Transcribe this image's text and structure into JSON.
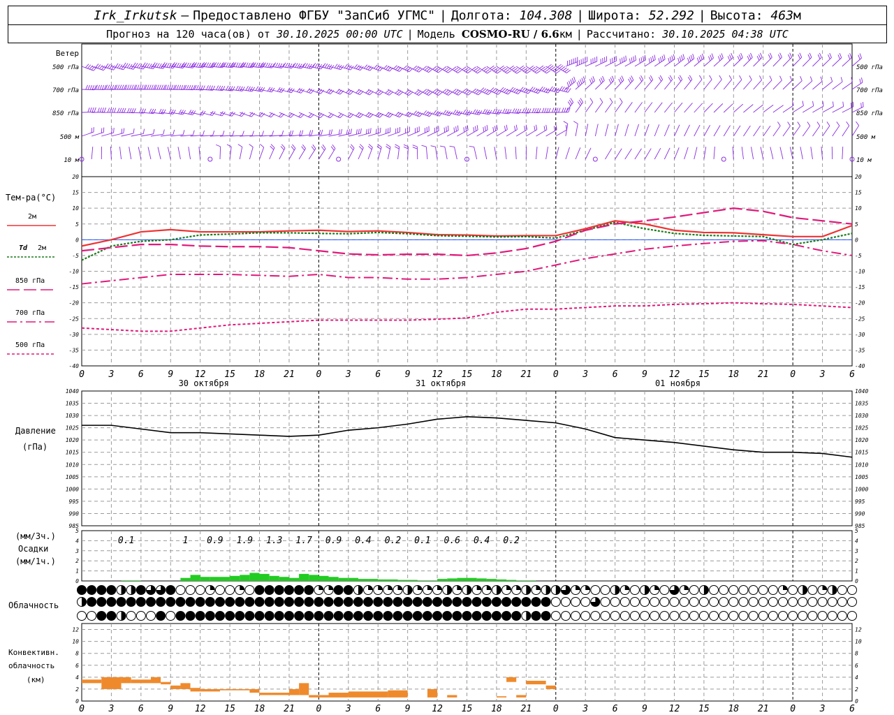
{
  "header": {
    "station": "Irk_Irkutsk",
    "dash": "—",
    "provider": "Предоставлено ФГБУ \"ЗапСиб УГМС\"",
    "lon_label": "Долгота:",
    "lon_value": "104.308",
    "lat_label": "Широта:",
    "lat_value": "52.292",
    "alt_label": "Высота:",
    "alt_value": "463",
    "alt_unit": "м",
    "forecast_prefix": "Прогноз на 120 часа(ов) от",
    "forecast_start": "30.10.2025 00:00 UTC",
    "model_label": "Модель",
    "model_name": "COSMO-RU / 6.6",
    "model_unit": "км",
    "calc_label": "Рассчитано:",
    "calc_time": "30.10.2025 04:38 UTC"
  },
  "labels": {
    "wind": "Ветер",
    "wind_levels": [
      "500 гПа",
      "700 гПа",
      "850 гПа",
      "500 м",
      "10 м"
    ],
    "temp_title": "Тем-ра(°С)",
    "legend_2m": "2м",
    "legend_td": "Td",
    "legend_td_level": "2м",
    "legend_850": "850 гПа",
    "legend_700": "700 гПа",
    "legend_500": "500 гПа",
    "pressure_title": "Давление",
    "pressure_unit": "(гПа)",
    "precip_3h": "(мм/3ч.)",
    "precip_title": "Осадки",
    "precip_1h": "(мм/1ч.)",
    "cloud_title": "Облачность",
    "conv_title_1": "Конвективн.",
    "conv_title_2": "облачность",
    "conv_unit": "(км)"
  },
  "colors": {
    "wind": "#8a2be2",
    "t2m": "#ee3333",
    "td": "#1a7a1a",
    "t850": "#e0197a",
    "precip": "#22cc22",
    "conv": "#ef8a2c",
    "pressure": "#000000"
  },
  "chart_data": [
    {
      "type": "line",
      "name": "temperature",
      "x_hours_ticks": [
        "0",
        "3",
        "6",
        "9",
        "12",
        "15",
        "18",
        "21",
        "0",
        "3",
        "6",
        "9",
        "12",
        "15",
        "18",
        "21",
        "0",
        "3",
        "6",
        "9",
        "12",
        "15",
        "18",
        "21",
        "0",
        "3",
        "6"
      ],
      "dates": [
        "30 октября",
        "31 октября",
        "01 ноября"
      ],
      "ylim": [
        -40,
        20
      ],
      "yticks": [
        20,
        15,
        10,
        5,
        0,
        -5,
        -10,
        -15,
        -20,
        -25,
        -30,
        -35,
        -40
      ],
      "x": [
        0,
        3,
        6,
        9,
        12,
        15,
        18,
        21,
        24,
        27,
        30,
        33,
        36,
        39,
        42,
        45,
        48,
        51,
        54,
        57,
        60,
        63,
        66,
        69,
        72,
        75,
        78
      ],
      "series": [
        {
          "name": "2м",
          "values": [
            -2,
            0,
            2.5,
            3.2,
            2.5,
            2.5,
            2.5,
            2.8,
            3,
            2.6,
            2.8,
            2.3,
            1.6,
            1.5,
            1.2,
            1.3,
            1.3,
            3.5,
            6,
            5,
            3,
            2.3,
            2.2,
            1.6,
            1,
            1,
            4.5
          ]
        },
        {
          "name": "Td 2м",
          "values": [
            -6.5,
            -2,
            -0.5,
            0,
            1.5,
            1.8,
            2.2,
            2.2,
            2,
            1.9,
            2.3,
            1.9,
            1.3,
            1.1,
            0.9,
            1,
            0.5,
            3,
            5.5,
            3.5,
            2,
            1.4,
            1.2,
            1,
            -1.5,
            0,
            2
          ]
        },
        {
          "name": "850 гПа",
          "values": [
            -3.5,
            -2.5,
            -1.5,
            -1.5,
            -2,
            -2.2,
            -2.2,
            -2.5,
            -3.5,
            -4.5,
            -4.8,
            -4.6,
            -4.6,
            -5,
            -4.2,
            -2.8,
            -0.5,
            3,
            5,
            6,
            7.2,
            8.6,
            10,
            9,
            7,
            6,
            5
          ]
        },
        {
          "name": "700 гПа",
          "values": [
            -14,
            -13,
            -12,
            -11,
            -11,
            -11,
            -11.3,
            -11.6,
            -11,
            -12,
            -12,
            -12.5,
            -12.5,
            -12,
            -11,
            -10,
            -8,
            -6,
            -4.5,
            -3,
            -2,
            -1.2,
            -0.5,
            -0.3,
            -1.5,
            -3.5,
            -5
          ]
        },
        {
          "name": "500 гПа",
          "values": [
            -28,
            -28.5,
            -29,
            -29,
            -28,
            -27,
            -26.5,
            -26,
            -25.5,
            -25.5,
            -25.5,
            -25.5,
            -25.2,
            -24.8,
            -23,
            -22,
            -22,
            -21.5,
            -21,
            -21,
            -20.5,
            -20.3,
            -20,
            -20.3,
            -20.5,
            -21,
            -21.5
          ]
        }
      ]
    },
    {
      "type": "line",
      "name": "pressure",
      "ylim": [
        985,
        1040
      ],
      "yticks": [
        1040,
        1035,
        1030,
        1025,
        1020,
        1015,
        1010,
        1005,
        1000,
        995,
        990,
        985
      ],
      "x": [
        0,
        3,
        6,
        9,
        12,
        15,
        18,
        21,
        24,
        27,
        30,
        33,
        36,
        39,
        42,
        45,
        48,
        51,
        54,
        57,
        60,
        63,
        66,
        69,
        72,
        75,
        78
      ],
      "values": [
        1026,
        1026,
        1024.5,
        1023,
        1023,
        1022.5,
        1022,
        1021.5,
        1022,
        1024,
        1025,
        1026.5,
        1028.5,
        1029.5,
        1029,
        1028,
        1027,
        1024.5,
        1021,
        1020,
        1019,
        1017.5,
        1016,
        1015,
        1015,
        1014.5,
        1013
      ]
    },
    {
      "type": "bar",
      "name": "precipitation",
      "ylim": [
        0,
        5
      ],
      "yticks": [
        5,
        4,
        3,
        2,
        1,
        0
      ],
      "labels_3h": [
        {
          "h": 4.5,
          "v": "0.1"
        },
        {
          "h": 10.5,
          "v": "1"
        },
        {
          "h": 13.5,
          "v": "0.9"
        },
        {
          "h": 16.5,
          "v": "1.9"
        },
        {
          "h": 19.5,
          "v": "1.3"
        },
        {
          "h": 22.5,
          "v": "1.7"
        },
        {
          "h": 25.5,
          "v": "0.9"
        },
        {
          "h": 28.5,
          "v": "0.4"
        },
        {
          "h": 31.5,
          "v": "0.2"
        },
        {
          "h": 34.5,
          "v": "0.1"
        },
        {
          "h": 37.5,
          "v": "0.6"
        },
        {
          "h": 40.5,
          "v": "0.4"
        },
        {
          "h": 43.5,
          "v": "0.2"
        }
      ],
      "hourly": [
        0,
        0,
        0,
        0,
        0.05,
        0.05,
        0,
        0,
        0,
        0,
        0.3,
        0.6,
        0.4,
        0.4,
        0.4,
        0.5,
        0.6,
        0.8,
        0.7,
        0.5,
        0.4,
        0.3,
        0.7,
        0.6,
        0.5,
        0.4,
        0.3,
        0.3,
        0.2,
        0.2,
        0.15,
        0.15,
        0.1,
        0.1,
        0.05,
        0.05,
        0.2,
        0.25,
        0.3,
        0.3,
        0.25,
        0.2,
        0.15,
        0.1,
        0.05,
        0.05,
        0,
        0
      ]
    },
    {
      "type": "table",
      "name": "cloudiness",
      "rows": [
        "high",
        "middle",
        "low"
      ],
      "interval_hours": 1,
      "fraction_high": [
        8,
        8,
        8,
        8,
        4,
        4,
        8,
        6,
        6,
        8,
        0,
        0,
        0,
        2,
        0,
        0,
        2,
        0,
        8,
        8,
        8,
        8,
        8,
        8,
        2,
        2,
        8,
        8,
        4,
        2,
        2,
        2,
        2,
        4,
        2,
        2,
        2,
        4,
        2,
        4,
        2,
        2,
        4,
        2,
        2,
        4,
        2,
        4,
        4,
        6,
        2,
        2,
        0,
        0,
        4,
        2,
        0,
        4,
        2,
        0,
        6,
        2,
        0,
        4,
        0,
        0,
        0,
        0,
        0,
        0,
        0,
        2,
        0,
        4,
        0,
        2,
        4,
        0,
        0
      ],
      "fraction_middle": [
        4,
        8,
        8,
        8,
        8,
        8,
        8,
        8,
        8,
        8,
        8,
        8,
        8,
        8,
        8,
        8,
        8,
        8,
        8,
        8,
        8,
        8,
        8,
        8,
        8,
        8,
        8,
        8,
        8,
        8,
        8,
        8,
        8,
        8,
        8,
        8,
        8,
        8,
        8,
        8,
        8,
        8,
        8,
        8,
        8,
        8,
        8,
        8,
        0,
        0,
        0,
        0,
        6,
        0,
        0,
        0,
        0,
        0,
        0,
        0,
        0,
        0,
        0,
        0,
        0,
        0,
        0,
        0,
        0,
        0,
        0,
        0,
        0,
        0,
        0,
        0,
        0,
        0,
        0
      ],
      "fraction_low": [
        0,
        0,
        8,
        8,
        4,
        0,
        0,
        0,
        8,
        0,
        8,
        8,
        8,
        8,
        8,
        8,
        8,
        8,
        8,
        8,
        8,
        8,
        8,
        8,
        8,
        8,
        8,
        8,
        8,
        8,
        8,
        8,
        8,
        8,
        8,
        8,
        8,
        8,
        8,
        8,
        8,
        8,
        8,
        8,
        8,
        4,
        8,
        8,
        0,
        0,
        0,
        0,
        0,
        0,
        0,
        0,
        0,
        0,
        0,
        0,
        0,
        0,
        0,
        0,
        0,
        0,
        0,
        0,
        0,
        0,
        0,
        0,
        0,
        0,
        0,
        0,
        0,
        0,
        0
      ]
    },
    {
      "type": "bar",
      "name": "convective_cloudiness",
      "ylim": [
        0,
        13
      ],
      "yticks": [
        12,
        10,
        8,
        6,
        4,
        2,
        0
      ],
      "segments": [
        {
          "h0": 0,
          "h1": 2,
          "base": 3,
          "top": 3.6
        },
        {
          "h0": 2,
          "h1": 4,
          "base": 2,
          "top": 4
        },
        {
          "h0": 4,
          "h1": 5,
          "base": 3,
          "top": 4
        },
        {
          "h0": 5,
          "h1": 6,
          "base": 3,
          "top": 3.6
        },
        {
          "h0": 6,
          "h1": 7,
          "base": 3,
          "top": 3.6
        },
        {
          "h0": 7,
          "h1": 8,
          "base": 3,
          "top": 4
        },
        {
          "h0": 8,
          "h1": 9,
          "base": 2.8,
          "top": 3.2
        },
        {
          "h0": 9,
          "h1": 10,
          "base": 2,
          "top": 2.6
        },
        {
          "h0": 10,
          "h1": 11,
          "base": 2,
          "top": 3
        },
        {
          "h0": 11,
          "h1": 12,
          "base": 1.6,
          "top": 2.2
        },
        {
          "h0": 12,
          "h1": 14,
          "base": 1.6,
          "top": 2
        },
        {
          "h0": 14,
          "h1": 17,
          "base": 1.8,
          "top": 2
        },
        {
          "h0": 17,
          "h1": 18,
          "base": 1.4,
          "top": 2
        },
        {
          "h0": 18,
          "h1": 21,
          "base": 1,
          "top": 1.4
        },
        {
          "h0": 21,
          "h1": 22,
          "base": 1,
          "top": 2
        },
        {
          "h0": 22,
          "h1": 23,
          "base": 1,
          "top": 3
        },
        {
          "h0": 23,
          "h1": 25,
          "base": 0.6,
          "top": 1
        },
        {
          "h0": 25,
          "h1": 27,
          "base": 0.6,
          "top": 1.4
        },
        {
          "h0": 27,
          "h1": 31,
          "base": 0.6,
          "top": 1.6
        },
        {
          "h0": 31,
          "h1": 33,
          "base": 0.6,
          "top": 1.8
        },
        {
          "h0": 35,
          "h1": 36,
          "base": 0.6,
          "top": 2
        },
        {
          "h0": 37,
          "h1": 38,
          "base": 0.6,
          "top": 1
        },
        {
          "h0": 42,
          "h1": 43,
          "base": 0.6,
          "top": 0.8
        },
        {
          "h0": 43,
          "h1": 44,
          "base": 3.2,
          "top": 4
        },
        {
          "h0": 44,
          "h1": 45,
          "base": 0.6,
          "top": 1
        },
        {
          "h0": 45,
          "h1": 47,
          "base": 2.8,
          "top": 3.4
        },
        {
          "h0": 47,
          "h1": 48,
          "base": 2,
          "top": 2.6
        }
      ]
    }
  ]
}
